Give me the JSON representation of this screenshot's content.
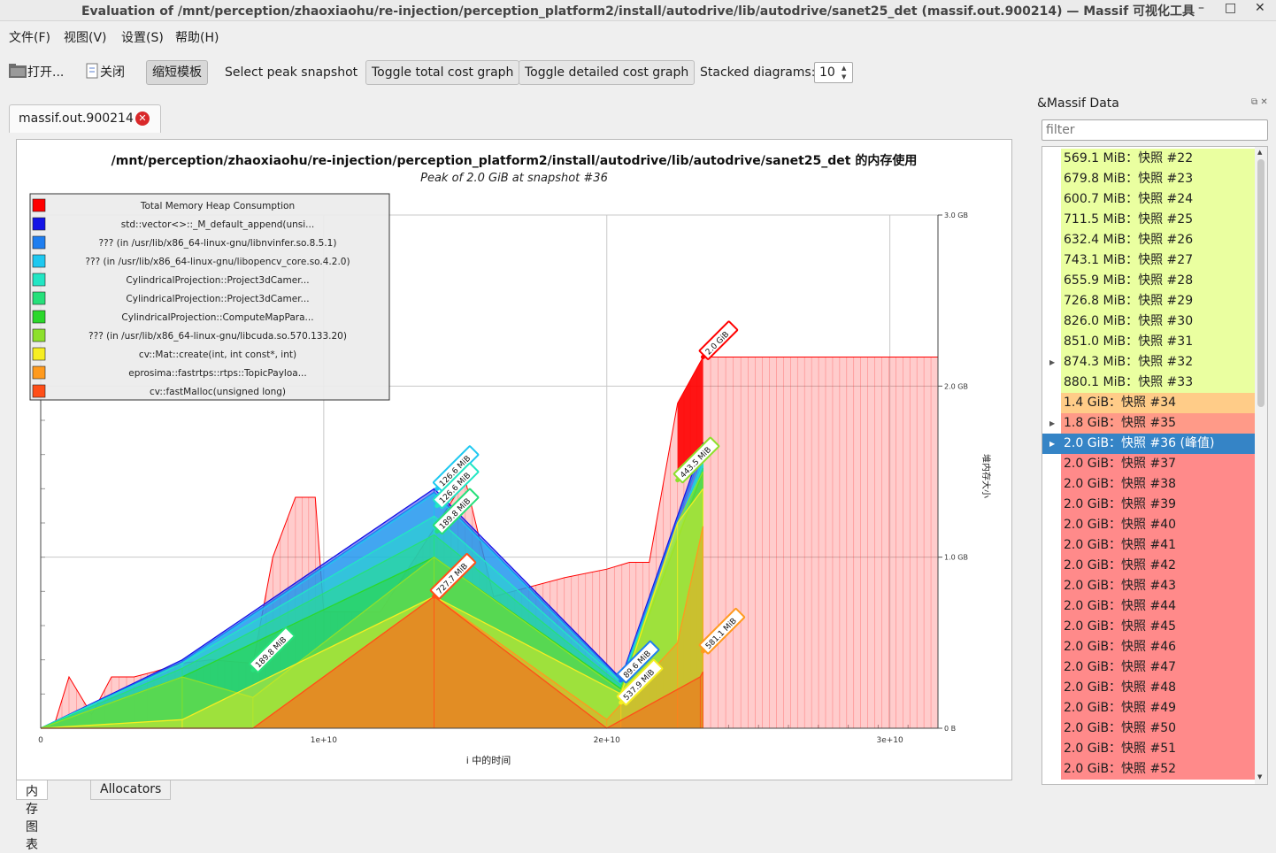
{
  "window": {
    "title": "Evaluation of /mnt/perception/zhaoxiaohu/re-injection/perception_platform2/install/autodrive/lib/autodrive/sanet25_det (massif.out.900214) — Massif 可视化工具",
    "minimize": "–",
    "maximize": "□",
    "close": "✕"
  },
  "menu": {
    "file": "文件(F)",
    "view": "视图(V)",
    "settings": "设置(S)",
    "help": "帮助(H)"
  },
  "toolbar": {
    "open": "打开...",
    "close": "关闭",
    "shorten_templates": "缩短模板",
    "select_peak": "Select peak snapshot",
    "toggle_total": "Toggle total cost graph",
    "toggle_detailed": "Toggle detailed cost graph",
    "stacked_label": "Stacked diagrams:",
    "stacked_value": "10"
  },
  "tab": {
    "label": "massif.out.900214",
    "close": "✕"
  },
  "bottom_tabs": [
    "内存图表",
    "Allocators"
  ],
  "panel": {
    "title": "&Massif Data",
    "icons": "⧉ ✕",
    "filter_placeholder": "filter",
    "rows": [
      {
        "label": "569.1 MiB：快照 #22",
        "color": "#eaffa0",
        "expand": ""
      },
      {
        "label": "679.8 MiB：快照 #23",
        "color": "#eaffa0",
        "expand": ""
      },
      {
        "label": "600.7 MiB：快照 #24",
        "color": "#eaffa0",
        "expand": ""
      },
      {
        "label": "711.5 MiB：快照 #25",
        "color": "#eaffa0",
        "expand": ""
      },
      {
        "label": "632.4 MiB：快照 #26",
        "color": "#eaffa0",
        "expand": ""
      },
      {
        "label": "743.1 MiB：快照 #27",
        "color": "#eaffa0",
        "expand": ""
      },
      {
        "label": "655.9 MiB：快照 #28",
        "color": "#eaffa0",
        "expand": ""
      },
      {
        "label": "726.8 MiB：快照 #29",
        "color": "#eaffa0",
        "expand": ""
      },
      {
        "label": "826.0 MiB：快照 #30",
        "color": "#eaffa0",
        "expand": ""
      },
      {
        "label": "851.0 MiB：快照 #31",
        "color": "#eaffa0",
        "expand": ""
      },
      {
        "label": "874.3 MiB：快照 #32",
        "color": "#eaffa0",
        "expand": "▶"
      },
      {
        "label": "880.1 MiB：快照 #33",
        "color": "#eaffa0",
        "expand": ""
      },
      {
        "label": "1.4 GiB：快照 #34",
        "color": "#ffcc88",
        "expand": ""
      },
      {
        "label": "1.8 GiB：快照 #35",
        "color": "#ff9a88",
        "expand": "▶"
      },
      {
        "label": "2.0 GiB：快照 #36 (峰值)",
        "color": "#3584c6",
        "expand": "▶",
        "selected": true
      },
      {
        "label": "2.0 GiB：快照 #37",
        "color": "#ff8a8a",
        "expand": ""
      },
      {
        "label": "2.0 GiB：快照 #38",
        "color": "#ff8a8a",
        "expand": ""
      },
      {
        "label": "2.0 GiB：快照 #39",
        "color": "#ff8a8a",
        "expand": ""
      },
      {
        "label": "2.0 GiB：快照 #40",
        "color": "#ff8a8a",
        "expand": ""
      },
      {
        "label": "2.0 GiB：快照 #41",
        "color": "#ff8a8a",
        "expand": ""
      },
      {
        "label": "2.0 GiB：快照 #42",
        "color": "#ff8a8a",
        "expand": ""
      },
      {
        "label": "2.0 GiB：快照 #43",
        "color": "#ff8a8a",
        "expand": ""
      },
      {
        "label": "2.0 GiB：快照 #44",
        "color": "#ff8a8a",
        "expand": ""
      },
      {
        "label": "2.0 GiB：快照 #45",
        "color": "#ff8a8a",
        "expand": ""
      },
      {
        "label": "2.0 GiB：快照 #46",
        "color": "#ff8a8a",
        "expand": ""
      },
      {
        "label": "2.0 GiB：快照 #47",
        "color": "#ff8a8a",
        "expand": ""
      },
      {
        "label": "2.0 GiB：快照 #48",
        "color": "#ff8a8a",
        "expand": ""
      },
      {
        "label": "2.0 GiB：快照 #49",
        "color": "#ff8a8a",
        "expand": ""
      },
      {
        "label": "2.0 GiB：快照 #50",
        "color": "#ff8a8a",
        "expand": ""
      },
      {
        "label": "2.0 GiB：快照 #51",
        "color": "#ff8a8a",
        "expand": ""
      },
      {
        "label": "2.0 GiB：快照 #52",
        "color": "#ff8a8a",
        "expand": ""
      }
    ]
  },
  "chart_data": {
    "type": "area",
    "title": "/mnt/perception/zhaoxiaohu/re-injection/perception_platform2/install/autodrive/lib/autodrive/sanet25_det 的内存使用",
    "subtitle": "Peak of 2.0 GiB at snapshot #36",
    "xlabel": "i 中的时间",
    "ylabel": "堆内存大小",
    "x_ticks": [
      {
        "v": 0,
        "label": "0"
      },
      {
        "v": 10000000000.0,
        "label": "1e+10"
      },
      {
        "v": 20000000000.0,
        "label": "2e+10"
      },
      {
        "v": 30000000000.0,
        "label": "3e+10"
      }
    ],
    "y_ticks": [
      {
        "v": 0,
        "label": "0 B"
      },
      {
        "v": 1.0,
        "label": "1.0 GB"
      },
      {
        "v": 2.0,
        "label": "2.0 GB"
      },
      {
        "v": 3.0,
        "label": "3.0 GB"
      }
    ],
    "xlim": [
      0,
      31700000000.0
    ],
    "ylim": [
      0,
      3.0
    ],
    "legend_position": "top-left",
    "total_series": {
      "name": "Total Memory Heap Consumption",
      "color": "#ff0000",
      "x": [
        0,
        500000000.0,
        1000000000.0,
        1800000000.0,
        2500000000.0,
        3300000000.0,
        4000000000.0,
        5000000000.0,
        6000000000.0,
        7500000000.0,
        8200000000.0,
        9000000000.0,
        9700000000.0,
        10000000000.0,
        10500000000.0,
        12000000000.0,
        15000000000.0,
        16000000000.0,
        18500000000.0,
        20000000000.0,
        20800000000.0,
        21500000000.0,
        22500000000.0,
        23400000000.0,
        25000000000.0,
        31700000000.0
      ],
      "y": [
        0,
        0.03,
        0.3,
        0.08,
        0.3,
        0.3,
        0.33,
        0.38,
        0.4,
        0.38,
        1.0,
        1.35,
        1.35,
        0.68,
        0.68,
        0.68,
        1.45,
        0.77,
        0.88,
        0.93,
        0.97,
        0.97,
        1.9,
        2.17,
        2.17,
        2.17
      ]
    },
    "stacked_series": [
      {
        "name": "cv::fastMalloc(unsigned long)",
        "color": "#ff4f18",
        "x": [
          0,
          7500000000.0,
          13900000000.0,
          20000000000.0,
          23300000000.0,
          23400000000.0
        ],
        "y": [
          0,
          0,
          0.77,
          0,
          0.3,
          0.33
        ]
      },
      {
        "name": "eprosima::fastrtps::rtps::TopicPayloa...",
        "color": "#ff9a1e",
        "x": [
          0,
          7500000000.0,
          13900000000.0,
          20000000000.0,
          22500000000.0,
          23400000000.0
        ],
        "y": [
          0,
          0,
          0.77,
          0.05,
          0.5,
          1.18
        ]
      },
      {
        "name": "cv::Mat::create(int, int const*, int)",
        "color": "#f6ee22",
        "x": [
          0,
          5000000000.0,
          13900000000.0,
          20500000000.0,
          22500000000.0,
          23400000000.0
        ],
        "y": [
          0,
          0.05,
          0.77,
          0.2,
          1.2,
          1.4
        ]
      },
      {
        "name": "??? (in /usr/lib/x86_64-linux-gnu/libcuda.so.570.133.20)",
        "color": "#8de02c",
        "x": [
          0,
          5000000000.0,
          7500000000.0,
          13900000000.0,
          20500000000.0,
          22500000000.0,
          23400000000.0
        ],
        "y": [
          0,
          0.3,
          0.18,
          1.0,
          0.22,
          1.2,
          1.5
        ]
      },
      {
        "name": "CylindricalProjection::ComputeMapPara...",
        "color": "#2bd82b",
        "x": [
          0,
          5000000000.0,
          13900000000.0,
          20500000000.0,
          23400000000.0
        ],
        "y": [
          0,
          0.3,
          1.0,
          0.23,
          1.5
        ]
      },
      {
        "name": "CylindricalProjection::Project3dCamer...",
        "color": "#26e07a",
        "x": [
          0,
          5000000000.0,
          13900000000.0,
          20500000000.0,
          23400000000.0
        ],
        "y": [
          0,
          0.35,
          1.13,
          0.25,
          1.52
        ]
      },
      {
        "name": "CylindricalProjection::Project3dCamer...",
        "color": "#22e6c4",
        "x": [
          0,
          5000000000.0,
          13900000000.0,
          20500000000.0,
          23400000000.0
        ],
        "y": [
          0,
          0.38,
          1.24,
          0.27,
          1.55
        ]
      },
      {
        "name": "??? (in /usr/lib/x86_64-linux-gnu/libopencv_core.so.4.2.0)",
        "color": "#1ec8f0",
        "x": [
          0,
          5000000000.0,
          13900000000.0,
          20500000000.0,
          23400000000.0
        ],
        "y": [
          0,
          0.38,
          1.37,
          0.27,
          1.58
        ]
      },
      {
        "name": "??? (in /usr/lib/x86_64-linux-gnu/libnvinfer.so.8.5.1)",
        "color": "#1e7ef0",
        "x": [
          0,
          5000000000.0,
          13900000000.0,
          20500000000.0,
          23400000000.0
        ],
        "y": [
          0,
          0.39,
          1.38,
          0.28,
          1.64
        ]
      },
      {
        "name": "std::vector<>::_M_default_append(unsi...",
        "color": "#1414e6",
        "x": [
          0,
          5000000000.0,
          13900000000.0,
          20500000000.0,
          23400000000.0
        ],
        "y": [
          0,
          0.4,
          1.4,
          0.29,
          1.67
        ]
      }
    ],
    "legend": [
      {
        "name": "Total Memory Heap Consumption",
        "color": "#ff0000"
      },
      {
        "name": "std::vector<>::_M_default_append(unsi...",
        "color": "#1414e6"
      },
      {
        "name": "??? (in /usr/lib/x86_64-linux-gnu/libnvinfer.so.8.5.1)",
        "color": "#1e7ef0"
      },
      {
        "name": "??? (in /usr/lib/x86_64-linux-gnu/libopencv_core.so.4.2.0)",
        "color": "#1ec8f0"
      },
      {
        "name": "CylindricalProjection::Project3dCamer...",
        "color": "#22e6c4"
      },
      {
        "name": "CylindricalProjection::Project3dCamer...",
        "color": "#26e07a"
      },
      {
        "name": "CylindricalProjection::ComputeMapPara...",
        "color": "#2bd82b"
      },
      {
        "name": "??? (in /usr/lib/x86_64-linux-gnu/libcuda.so.570.133.20)",
        "color": "#8de02c"
      },
      {
        "name": "cv::Mat::create(int, int const*, int)",
        "color": "#f6ee22"
      },
      {
        "name": "eprosima::fastrtps::rtps::TopicPayloa...",
        "color": "#ff9a1e"
      },
      {
        "name": "cv::fastMalloc(unsigned long)",
        "color": "#ff4f18"
      }
    ],
    "annotations": [
      {
        "text": "2.0 GiB",
        "x": 23400000000.0,
        "y": 2.17,
        "color": "#ff0000"
      },
      {
        "text": "126.6 MiB",
        "x": 14000000000.0,
        "y": 1.4,
        "color": "#1ec8f0"
      },
      {
        "text": "126.6 MiB",
        "x": 14000000000.0,
        "y": 1.3,
        "color": "#22e6c4"
      },
      {
        "text": "189.8 MiB",
        "x": 14000000000.0,
        "y": 1.15,
        "color": "#26e07a"
      },
      {
        "text": "727.7 MiB",
        "x": 13900000000.0,
        "y": 0.77,
        "color": "#ff4f18"
      },
      {
        "text": "189.8 MiB",
        "x": 7500000000.0,
        "y": 0.34,
        "color": "#26e07a"
      },
      {
        "text": "89.6 MiB",
        "x": 20500000000.0,
        "y": 0.28,
        "color": "#1e7ef0"
      },
      {
        "text": "537.9 MiB",
        "x": 20500000000.0,
        "y": 0.15,
        "color": "#f6ee22"
      },
      {
        "text": "443.5 MiB",
        "x": 22500000000.0,
        "y": 1.45,
        "color": "#8de02c"
      },
      {
        "text": "581.1 MiB",
        "x": 23400000000.0,
        "y": 0.45,
        "color": "#ff9a1e"
      }
    ]
  }
}
